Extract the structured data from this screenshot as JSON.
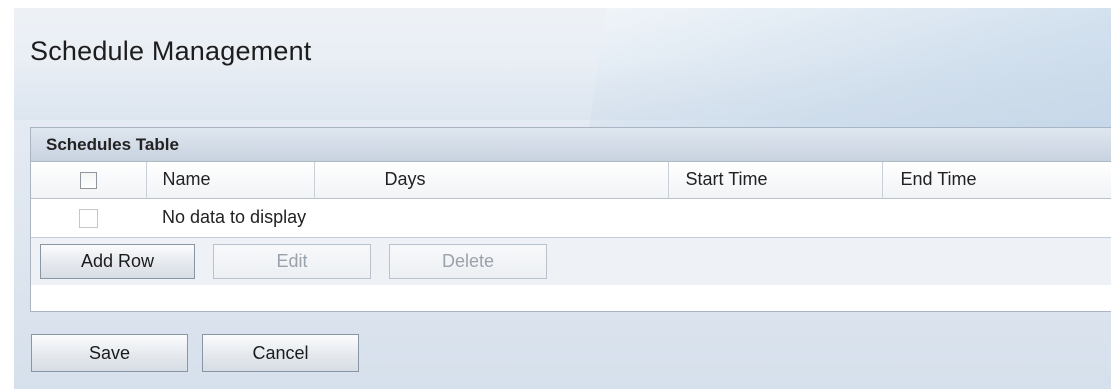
{
  "page": {
    "title": "Schedule Management"
  },
  "schedules_table": {
    "caption": "Schedules Table",
    "columns": [
      "Name",
      "Days",
      "Start Time",
      "End Time"
    ],
    "rows": [],
    "empty_message": "No data to display",
    "select_all_checked": false
  },
  "table_actions": {
    "add_row_label": "Add Row",
    "edit_label": "Edit",
    "delete_label": "Delete",
    "edit_enabled": false,
    "delete_enabled": false
  },
  "footer": {
    "save_label": "Save",
    "cancel_label": "Cancel"
  },
  "colors": {
    "panel_header": "#c8d3e0",
    "page_background": "#dfe7f1",
    "button_border": "#8a95a3",
    "disabled_text": "#9aa2ab"
  }
}
